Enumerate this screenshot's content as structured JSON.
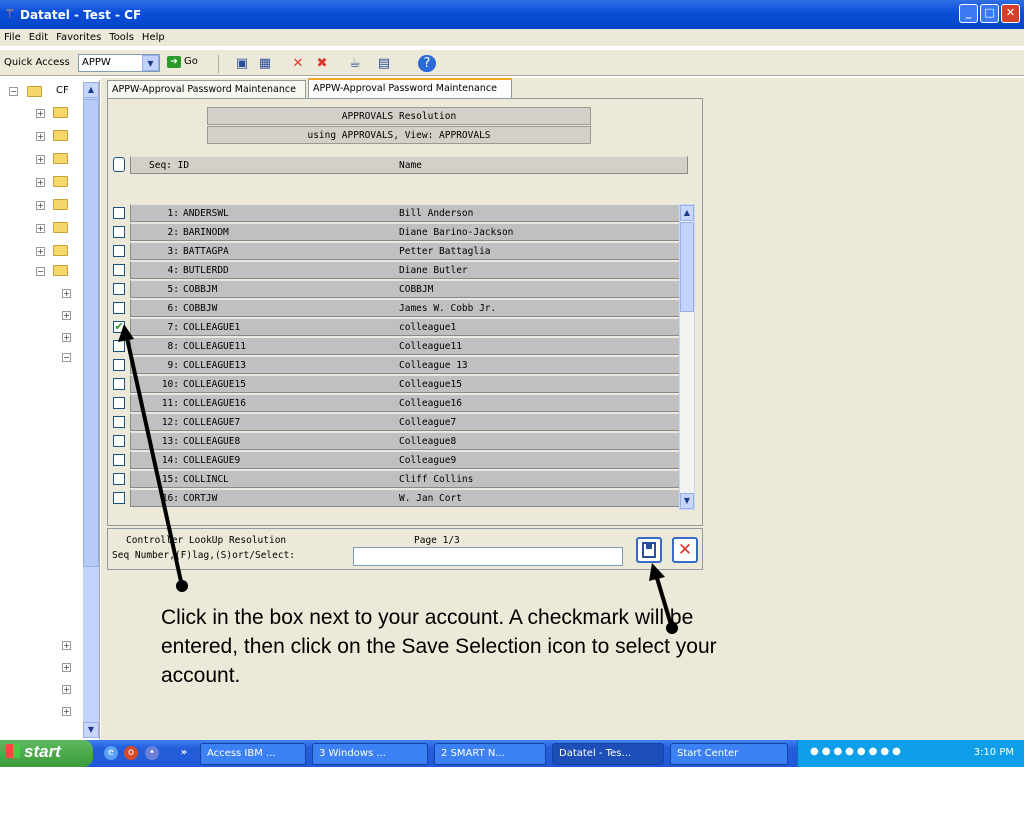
{
  "window": {
    "title": "Datatel - Test - CF",
    "buttons": [
      "minimize",
      "maximize",
      "close"
    ]
  },
  "menu": [
    "File",
    "Edit",
    "Favorites",
    "Tools",
    "Help"
  ],
  "toolbar": {
    "quick_access_label": "Quick Access",
    "quick_access_value": "APPW",
    "go_label": "Go",
    "icons": [
      "save-icon",
      "save-all-icon",
      "delete-icon",
      "delete-all-icon",
      "clear-icon",
      "list-icon",
      "help-icon"
    ]
  },
  "tree": {
    "root_label": "CF"
  },
  "tabs": [
    "APPW-Approval Password Maintenance",
    "APPW-Approval Password Maintenance"
  ],
  "header": {
    "line1": "APPROVALS Resolution",
    "line2": "using APPROVALS, View: APPROVALS",
    "col_seq": "Seq: ID",
    "col_name": "Name"
  },
  "rows": [
    {
      "seq": "1:",
      "id": "ANDERSWL",
      "name": "Bill Anderson",
      "checked": false
    },
    {
      "seq": "2:",
      "id": "BARINODM",
      "name": "Diane Barino-Jackson",
      "checked": false
    },
    {
      "seq": "3:",
      "id": "BATTAGPA",
      "name": "Petter Battaglia",
      "checked": false
    },
    {
      "seq": "4:",
      "id": "BUTLERDD",
      "name": "Diane Butler",
      "checked": false
    },
    {
      "seq": "5:",
      "id": "COBBJM",
      "name": "COBBJM",
      "checked": false
    },
    {
      "seq": "6:",
      "id": "COBBJW",
      "name": "James W. Cobb Jr.",
      "checked": false
    },
    {
      "seq": "7:",
      "id": "COLLEAGUE1",
      "name": "colleague1",
      "checked": true
    },
    {
      "seq": "8:",
      "id": "COLLEAGUE11",
      "name": "Colleague11",
      "checked": false
    },
    {
      "seq": "9:",
      "id": "COLLEAGUE13",
      "name": "Colleague 13",
      "checked": false
    },
    {
      "seq": "10:",
      "id": "COLLEAGUE15",
      "name": "Colleague15",
      "checked": false
    },
    {
      "seq": "11:",
      "id": "COLLEAGUE16",
      "name": "Colleague16",
      "checked": false
    },
    {
      "seq": "12:",
      "id": "COLLEAGUE7",
      "name": "Colleague7",
      "checked": false
    },
    {
      "seq": "13:",
      "id": "COLLEAGUE8",
      "name": "Colleague8",
      "checked": false
    },
    {
      "seq": "14:",
      "id": "COLLEAGUE9",
      "name": "Colleague9",
      "checked": false
    },
    {
      "seq": "15:",
      "id": "COLLINCL",
      "name": "Cliff Collins",
      "checked": false
    },
    {
      "seq": "16:",
      "id": "CORTJW",
      "name": "W. Jan Cort",
      "checked": false
    }
  ],
  "footer": {
    "controller": "Controller LookUp Resolution",
    "page": "Page 1/3",
    "prompt": "Seq Number,(F)lag,(S)ort/Select:",
    "input_value": ""
  },
  "instruction": "Click in the box next to your account.  A checkmark will be entered, then click on the Save Selection icon to select your account.",
  "taskbar": {
    "start": "start",
    "items": [
      "Access IBM ...",
      "3 Windows ...",
      "2 SMART N...",
      "Datatel - Tes...",
      "Start Center"
    ],
    "active_index": 3,
    "clock": "3:10 PM"
  },
  "colors": {
    "title_blue": "#0a4ed9",
    "checkmark": "#2a9a2a",
    "cancel_red": "#e0362b",
    "taskbar_blue": "#245edb",
    "start_green": "#3a9b3a"
  }
}
